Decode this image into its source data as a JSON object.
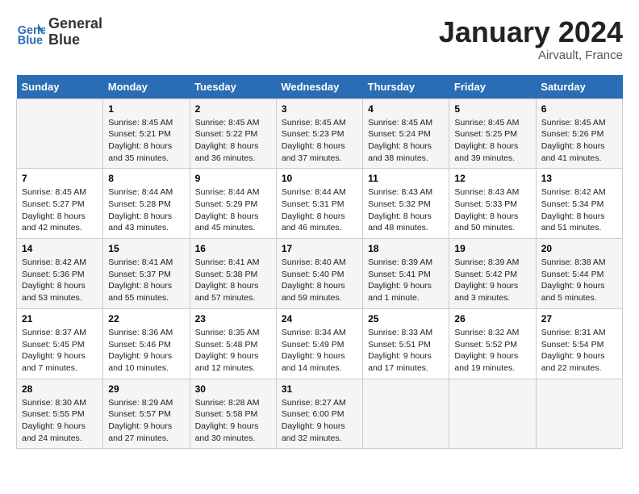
{
  "header": {
    "logo_line1": "General",
    "logo_line2": "Blue",
    "main_title": "January 2024",
    "subtitle": "Airvault, France"
  },
  "columns": [
    "Sunday",
    "Monday",
    "Tuesday",
    "Wednesday",
    "Thursday",
    "Friday",
    "Saturday"
  ],
  "weeks": [
    [
      {
        "day": "",
        "content": ""
      },
      {
        "day": "1",
        "content": "Sunrise: 8:45 AM\nSunset: 5:21 PM\nDaylight: 8 hours\nand 35 minutes."
      },
      {
        "day": "2",
        "content": "Sunrise: 8:45 AM\nSunset: 5:22 PM\nDaylight: 8 hours\nand 36 minutes."
      },
      {
        "day": "3",
        "content": "Sunrise: 8:45 AM\nSunset: 5:23 PM\nDaylight: 8 hours\nand 37 minutes."
      },
      {
        "day": "4",
        "content": "Sunrise: 8:45 AM\nSunset: 5:24 PM\nDaylight: 8 hours\nand 38 minutes."
      },
      {
        "day": "5",
        "content": "Sunrise: 8:45 AM\nSunset: 5:25 PM\nDaylight: 8 hours\nand 39 minutes."
      },
      {
        "day": "6",
        "content": "Sunrise: 8:45 AM\nSunset: 5:26 PM\nDaylight: 8 hours\nand 41 minutes."
      }
    ],
    [
      {
        "day": "7",
        "content": "Sunrise: 8:45 AM\nSunset: 5:27 PM\nDaylight: 8 hours\nand 42 minutes."
      },
      {
        "day": "8",
        "content": "Sunrise: 8:44 AM\nSunset: 5:28 PM\nDaylight: 8 hours\nand 43 minutes."
      },
      {
        "day": "9",
        "content": "Sunrise: 8:44 AM\nSunset: 5:29 PM\nDaylight: 8 hours\nand 45 minutes."
      },
      {
        "day": "10",
        "content": "Sunrise: 8:44 AM\nSunset: 5:31 PM\nDaylight: 8 hours\nand 46 minutes."
      },
      {
        "day": "11",
        "content": "Sunrise: 8:43 AM\nSunset: 5:32 PM\nDaylight: 8 hours\nand 48 minutes."
      },
      {
        "day": "12",
        "content": "Sunrise: 8:43 AM\nSunset: 5:33 PM\nDaylight: 8 hours\nand 50 minutes."
      },
      {
        "day": "13",
        "content": "Sunrise: 8:42 AM\nSunset: 5:34 PM\nDaylight: 8 hours\nand 51 minutes."
      }
    ],
    [
      {
        "day": "14",
        "content": "Sunrise: 8:42 AM\nSunset: 5:36 PM\nDaylight: 8 hours\nand 53 minutes."
      },
      {
        "day": "15",
        "content": "Sunrise: 8:41 AM\nSunset: 5:37 PM\nDaylight: 8 hours\nand 55 minutes."
      },
      {
        "day": "16",
        "content": "Sunrise: 8:41 AM\nSunset: 5:38 PM\nDaylight: 8 hours\nand 57 minutes."
      },
      {
        "day": "17",
        "content": "Sunrise: 8:40 AM\nSunset: 5:40 PM\nDaylight: 8 hours\nand 59 minutes."
      },
      {
        "day": "18",
        "content": "Sunrise: 8:39 AM\nSunset: 5:41 PM\nDaylight: 9 hours\nand 1 minute."
      },
      {
        "day": "19",
        "content": "Sunrise: 8:39 AM\nSunset: 5:42 PM\nDaylight: 9 hours\nand 3 minutes."
      },
      {
        "day": "20",
        "content": "Sunrise: 8:38 AM\nSunset: 5:44 PM\nDaylight: 9 hours\nand 5 minutes."
      }
    ],
    [
      {
        "day": "21",
        "content": "Sunrise: 8:37 AM\nSunset: 5:45 PM\nDaylight: 9 hours\nand 7 minutes."
      },
      {
        "day": "22",
        "content": "Sunrise: 8:36 AM\nSunset: 5:46 PM\nDaylight: 9 hours\nand 10 minutes."
      },
      {
        "day": "23",
        "content": "Sunrise: 8:35 AM\nSunset: 5:48 PM\nDaylight: 9 hours\nand 12 minutes."
      },
      {
        "day": "24",
        "content": "Sunrise: 8:34 AM\nSunset: 5:49 PM\nDaylight: 9 hours\nand 14 minutes."
      },
      {
        "day": "25",
        "content": "Sunrise: 8:33 AM\nSunset: 5:51 PM\nDaylight: 9 hours\nand 17 minutes."
      },
      {
        "day": "26",
        "content": "Sunrise: 8:32 AM\nSunset: 5:52 PM\nDaylight: 9 hours\nand 19 minutes."
      },
      {
        "day": "27",
        "content": "Sunrise: 8:31 AM\nSunset: 5:54 PM\nDaylight: 9 hours\nand 22 minutes."
      }
    ],
    [
      {
        "day": "28",
        "content": "Sunrise: 8:30 AM\nSunset: 5:55 PM\nDaylight: 9 hours\nand 24 minutes."
      },
      {
        "day": "29",
        "content": "Sunrise: 8:29 AM\nSunset: 5:57 PM\nDaylight: 9 hours\nand 27 minutes."
      },
      {
        "day": "30",
        "content": "Sunrise: 8:28 AM\nSunset: 5:58 PM\nDaylight: 9 hours\nand 30 minutes."
      },
      {
        "day": "31",
        "content": "Sunrise: 8:27 AM\nSunset: 6:00 PM\nDaylight: 9 hours\nand 32 minutes."
      },
      {
        "day": "",
        "content": ""
      },
      {
        "day": "",
        "content": ""
      },
      {
        "day": "",
        "content": ""
      }
    ]
  ]
}
